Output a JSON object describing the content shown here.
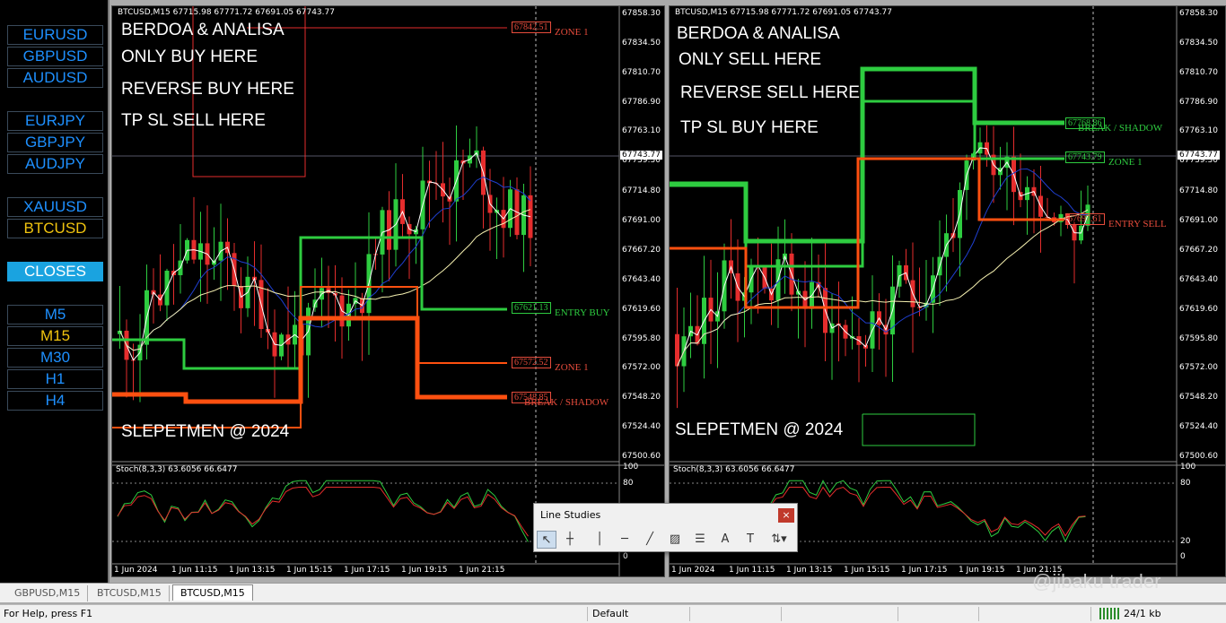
{
  "sidebar": {
    "buttons": [
      "EURUSD",
      "GBPUSD",
      "AUDUSD",
      "EURJPY",
      "GBPJPY",
      "AUDJPY",
      "XAUUSD",
      "BTCUSD",
      "CLOSES",
      "M5",
      "M15",
      "M30",
      "H1",
      "H4"
    ]
  },
  "charts": [
    {
      "header": "BTCUSD,M15  67715.98 67771.72 67691.05 67743.77",
      "texts": [
        "BERDOA & ANALISA",
        "ONLY BUY HERE",
        "REVERSE BUY HERE",
        "TP SL SELL HERE",
        "SLEPETMEN @ 2024"
      ],
      "labels": [
        {
          "value": "67842.51",
          "zone": "ZONE 1",
          "color": "#e74c3c"
        },
        {
          "value": "67621.13",
          "zone": "ENTRY BUY",
          "color": "#2ecc40"
        },
        {
          "value": "67572.52",
          "zone": "ZONE 1",
          "color": "#e74c3c"
        },
        {
          "value": "67548.85",
          "zone": "BREAK / SHADOW",
          "color": "#e74c3c"
        }
      ],
      "stoch": "Stoch(8,3,3) 63.6056 66.6477",
      "current_price": "67743.77"
    },
    {
      "header": "BTCUSD,M15  67715.98 67771.72 67691.05 67743.77",
      "texts": [
        "BERDOA & ANALISA",
        "ONLY SELL HERE",
        "REVERSE SELL HERE",
        "TP SL BUY HERE",
        "SLEPETMEN @ 2024"
      ],
      "labels": [
        {
          "value": "67768.86",
          "zone": "BREAK / SHADOW",
          "color": "#2ecc40"
        },
        {
          "value": "67743.79",
          "zone": "ZONE 1",
          "color": "#2ecc40"
        },
        {
          "value": "67697.61",
          "zone": "ENTRY SELL",
          "color": "#e74c3c"
        }
      ],
      "stoch": "Stoch(8,3,3) 63.6056 66.6477",
      "current_price": "67743.77"
    }
  ],
  "price_axis": [
    "67858.30",
    "67834.50",
    "67810.70",
    "67786.90",
    "67763.10",
    "67739.30",
    "67714.80",
    "67691.00",
    "67667.20",
    "67643.40",
    "67619.60",
    "67595.80",
    "67572.00",
    "67548.20",
    "67524.40",
    "67500.60"
  ],
  "stoch_axis": [
    "100",
    "80",
    "20",
    "0"
  ],
  "time_axis": [
    "1 Jun 2024",
    "1 Jun 11:15",
    "1 Jun 13:15",
    "1 Jun 15:15",
    "1 Jun 17:15",
    "1 Jun 19:15",
    "1 Jun 21:15"
  ],
  "tabs": [
    "GBPUSD,M15",
    "BTCUSD,M15",
    "BTCUSD,M15"
  ],
  "status": {
    "help": "For Help, press F1",
    "profile": "Default",
    "traffic": "24/1 kb"
  },
  "line_studies": {
    "title": "Line Studies",
    "close": "×"
  },
  "watermark": "@jibaku trader",
  "colors": {
    "bull": "#2ecc40",
    "bear": "#e52d2d",
    "orange": "#ff5010",
    "ma_blue": "#1f3fd0",
    "ma_white": "#ffffff",
    "ma_yellow": "#f5f0b0"
  }
}
